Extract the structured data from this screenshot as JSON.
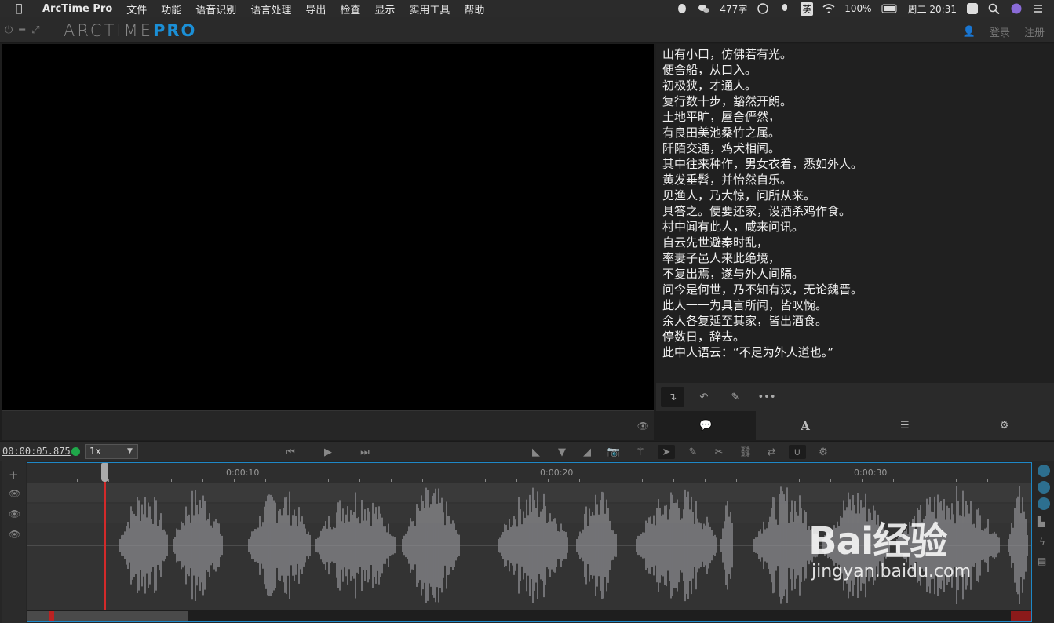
{
  "menubar": {
    "app_name": "ArcTime Pro",
    "items": [
      "文件",
      "功能",
      "语音识别",
      "语言处理",
      "导出",
      "检查",
      "显示",
      "实用工具",
      "帮助"
    ],
    "status": {
      "char_count": "477字",
      "input_method": "英",
      "battery": "100%",
      "clock": "周二 20:31"
    }
  },
  "appbar": {
    "logo_main": "ARCTIME",
    "logo_pro": "PRO",
    "login": "登录",
    "register": "注册"
  },
  "subtitles": [
    "山有小口，仿佛若有光。",
    "便舍船，从口入。",
    "初极狭，才通人。",
    "复行数十步，豁然开朗。",
    "土地平旷，屋舍俨然，",
    "有良田美池桑竹之属。",
    "阡陌交通，鸡犬相闻。",
    "其中往来种作，男女衣着，悉如外人。",
    "黄发垂髫，并怡然自乐。",
    "见渔人，乃大惊，问所从来。",
    "具答之。便要还家，设酒杀鸡作食。",
    "村中闻有此人，咸来问讯。",
    "自云先世避秦时乱，",
    "率妻子邑人来此绝境，",
    "不复出焉，遂与外人间隔。",
    "问今是何世，乃不知有汉，无论魏晋。",
    "此人一一为具言所闻，皆叹惋。",
    "余人各复延至其家，皆出酒食。",
    "停数日，辞去。",
    "此中人语云：“不足为外人道也。”"
  ],
  "panel_tabs": [
    "chat-icon",
    "text-style-icon",
    "list-icon",
    "sliders-icon"
  ],
  "panel_tab_glyphs": [
    "💬",
    "A",
    "☰",
    "⚙"
  ],
  "transport": {
    "timecode": "00:00:05.875",
    "speed": "1x"
  },
  "ruler": {
    "labels": [
      "0:00:10",
      "0:00:20",
      "0:00:30"
    ]
  },
  "watermark": {
    "brand": "Bai经验",
    "url": "jingyan.baidu.com"
  },
  "colors": {
    "accent": "#1b8fd6",
    "playhead": "#d32a2a",
    "status_dot": "#1fa84a",
    "track_border": "#1e88c7"
  }
}
